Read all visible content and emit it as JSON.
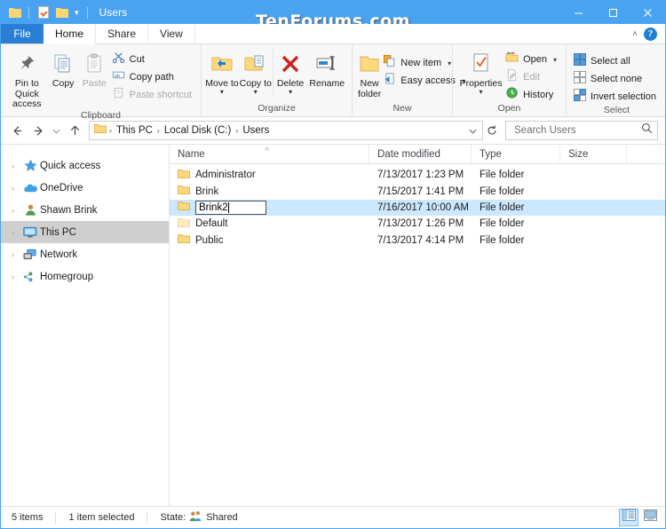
{
  "window": {
    "title": "Users",
    "watermark": "TenForums.com",
    "quick_access": [
      {
        "name": "qat-folder-icon",
        "icon": "folder-icon"
      },
      {
        "name": "qat-properties-icon",
        "icon": "properties-document-icon"
      },
      {
        "name": "qat-new-folder-icon",
        "icon": "folder-icon"
      },
      {
        "name": "qat-customize-caret",
        "icon": "chevron-down-icon"
      }
    ],
    "controls": {
      "minimize": "–",
      "maximize": "□",
      "close": "✕"
    }
  },
  "tabs": [
    {
      "label": "File",
      "active": false,
      "is_file": true
    },
    {
      "label": "Home",
      "active": true,
      "is_file": false
    },
    {
      "label": "Share",
      "active": false,
      "is_file": false
    },
    {
      "label": "View",
      "active": false,
      "is_file": false
    }
  ],
  "tabstrip_right": {
    "collapse_ribbon": "˄",
    "help": "?"
  },
  "ribbon": {
    "groups": [
      {
        "label": "Clipboard",
        "big_buttons": [
          {
            "label": "Pin to Quick access",
            "icon": "pin-icon",
            "disabled": false
          },
          {
            "label": "Copy",
            "icon": "copy-icon",
            "disabled": false
          },
          {
            "label": "Paste",
            "icon": "paste-icon",
            "disabled": true
          }
        ],
        "small_buttons": [
          {
            "label": "Cut",
            "icon": "scissors-icon",
            "disabled": false,
            "caret": false
          },
          {
            "label": "Copy path",
            "icon": "copy-path-icon",
            "disabled": false,
            "caret": false
          },
          {
            "label": "Paste shortcut",
            "icon": "paste-shortcut-icon",
            "disabled": true,
            "caret": false
          }
        ]
      },
      {
        "label": "Organize",
        "big_buttons": [
          {
            "label": "Move to",
            "icon": "move-to-icon",
            "disabled": false,
            "caret": true
          },
          {
            "label": "Copy to",
            "icon": "copy-to-icon",
            "disabled": false,
            "caret": true
          },
          {
            "label": "Delete",
            "icon": "delete-x-icon",
            "disabled": false,
            "caret": true
          },
          {
            "label": "Rename",
            "icon": "rename-icon",
            "disabled": false,
            "caret": false
          }
        ],
        "small_buttons": []
      },
      {
        "label": "New",
        "big_buttons": [
          {
            "label": "New folder",
            "icon": "new-folder-icon",
            "disabled": false
          }
        ],
        "small_buttons": [
          {
            "label": "New item",
            "icon": "new-item-icon",
            "disabled": false,
            "caret": true
          },
          {
            "label": "Easy access",
            "icon": "easy-access-icon",
            "disabled": false,
            "caret": true
          }
        ]
      },
      {
        "label": "Open",
        "big_buttons": [
          {
            "label": "Properties",
            "icon": "properties-icon",
            "disabled": false,
            "caret": true
          }
        ],
        "small_buttons": [
          {
            "label": "Open",
            "icon": "open-folder-icon",
            "disabled": false,
            "caret": true
          },
          {
            "label": "Edit",
            "icon": "edit-icon",
            "disabled": true,
            "caret": false
          },
          {
            "label": "History",
            "icon": "history-icon",
            "disabled": false,
            "caret": false
          }
        ]
      },
      {
        "label": "Select",
        "big_buttons": [],
        "small_buttons": [
          {
            "label": "Select all",
            "icon": "select-all-icon",
            "disabled": false,
            "caret": false
          },
          {
            "label": "Select none",
            "icon": "select-none-icon",
            "disabled": false,
            "caret": false
          },
          {
            "label": "Invert selection",
            "icon": "invert-selection-icon",
            "disabled": false,
            "caret": false
          }
        ]
      }
    ]
  },
  "addressbar": {
    "back": "←",
    "forward": "→",
    "recent": "˅",
    "up": "↑",
    "crumbs": [
      "This PC",
      "Local Disk (C:)",
      "Users"
    ],
    "crumb_sep": "›",
    "dropdown": "˅",
    "refresh": "↻"
  },
  "search": {
    "placeholder": "Search Users",
    "value": "",
    "icon": "search-icon"
  },
  "navpane": {
    "items": [
      {
        "label": "Quick access",
        "icon": "star-icon",
        "selected": false
      },
      {
        "label": "OneDrive",
        "icon": "cloud-icon",
        "selected": false
      },
      {
        "label": "Shawn Brink",
        "icon": "user-icon",
        "selected": false
      },
      {
        "label": "This PC",
        "icon": "monitor-icon",
        "selected": true
      },
      {
        "label": "Network",
        "icon": "network-icon",
        "selected": false
      },
      {
        "label": "Homegroup",
        "icon": "homegroup-icon",
        "selected": false
      }
    ],
    "expander": "›"
  },
  "filelist": {
    "columns": [
      {
        "label": "Name",
        "key": "name"
      },
      {
        "label": "Date modified",
        "key": "date"
      },
      {
        "label": "Type",
        "key": "type"
      },
      {
        "label": "Size",
        "key": "size"
      }
    ],
    "sort_indicator": "˄",
    "rows": [
      {
        "name": "Administrator",
        "date": "7/13/2017 1:23 PM",
        "type": "File folder",
        "size": "",
        "selected": false,
        "editing": false,
        "dim_icon": false
      },
      {
        "name": "Brink",
        "date": "7/15/2017 1:41 PM",
        "type": "File folder",
        "size": "",
        "selected": false,
        "editing": false,
        "dim_icon": false
      },
      {
        "name": "Brink2",
        "date": "7/16/2017 10:00 AM",
        "type": "File folder",
        "size": "",
        "selected": true,
        "editing": true,
        "dim_icon": false
      },
      {
        "name": "Default",
        "date": "7/13/2017 1:26 PM",
        "type": "File folder",
        "size": "",
        "selected": false,
        "editing": false,
        "dim_icon": true
      },
      {
        "name": "Public",
        "date": "7/13/2017 4:14 PM",
        "type": "File folder",
        "size": "",
        "selected": false,
        "editing": false,
        "dim_icon": false
      }
    ]
  },
  "statusbar": {
    "item_count": "5 items",
    "selection": "1 item selected",
    "state_label": "State:",
    "state_value": "Shared",
    "state_icon": "shared-people-icon",
    "views": [
      {
        "name": "details-view-button",
        "icon": "details-view-icon",
        "active": true
      },
      {
        "name": "large-icons-view-button",
        "icon": "large-icons-view-icon",
        "active": false
      }
    ]
  },
  "colors": {
    "titlebar": "#4aa3f0",
    "file_tab": "#2a7fd4",
    "selection": "#cce8ff",
    "nav_selection": "#cfcfcf",
    "ribbon_bg": "#f7f7f7",
    "folder": "#fdd87d"
  }
}
